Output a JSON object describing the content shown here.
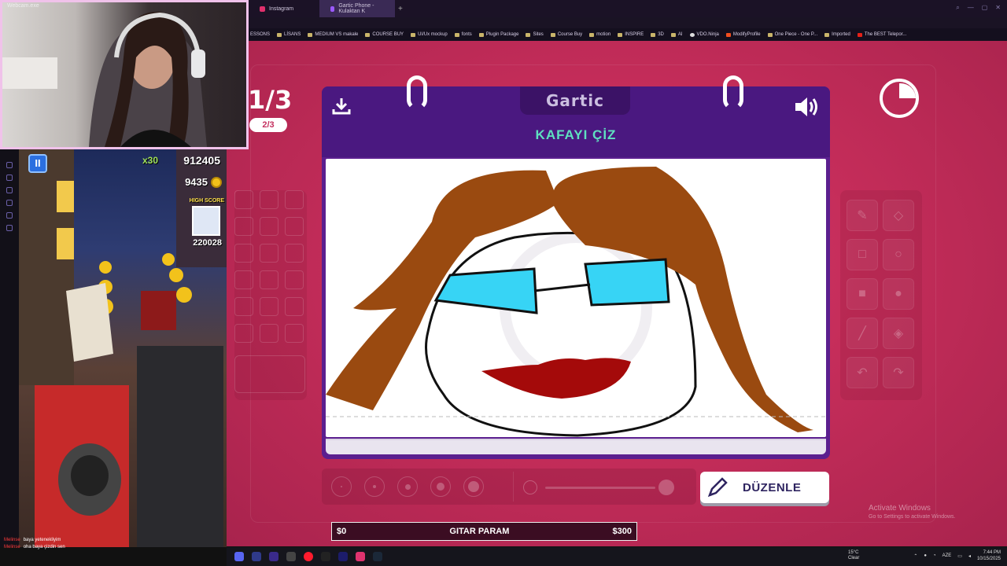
{
  "browser": {
    "tabs": [
      {
        "label": "Instagram",
        "active": false
      },
      {
        "label": "Gartic Phone - Kulaktan K",
        "active": true
      }
    ],
    "new_tab": "+",
    "bookmarks": [
      "ESSONS",
      "LİSANS",
      "MEDIUM VS makale",
      "COURSE BUY",
      "UI/Ux mockup",
      "fonts",
      "Plugin Package",
      "Sites",
      "Course Buy",
      "motion",
      "INSPIRE",
      "3D",
      "AI",
      "VDO.Ninja",
      "ModifyProfile",
      "One Piece - One P...",
      "Imported",
      "The BEST Telepor..."
    ]
  },
  "webcam": {
    "title": "Webcam.exe"
  },
  "subway": {
    "multiplier": "x30",
    "score": "912405",
    "coins": "9435",
    "high_score_label": "HIGH SCORE",
    "high_score": "220028",
    "pause_label": "II"
  },
  "chat": [
    {
      "user": "Melinse",
      "text": "baya yetenekliyim"
    },
    {
      "user": "Melinse",
      "text": "oha baya çizdin sen"
    }
  ],
  "game": {
    "round_big": "1/3",
    "round_small": "2/3",
    "logo": "Gartic",
    "prompt": "KAFAYI ÇİZ",
    "edit_button": "DÜZENLE",
    "accent_colors": {
      "background": "#c52d5a",
      "notebook": "#5b1f8f",
      "prompt": "#5fe0c0"
    }
  },
  "donation": {
    "min": "$0",
    "title": "GITAR PARAM",
    "max": "$300",
    "progress": 0
  },
  "activate_windows": {
    "title": "Activate Windows",
    "subtitle": "Go to Settings to activate Windows."
  },
  "taskbar": {
    "weather_temp": "15°C",
    "weather_desc": "Clear",
    "language": "AZE",
    "time": "7:44 PM",
    "date": "10/15/2025"
  }
}
